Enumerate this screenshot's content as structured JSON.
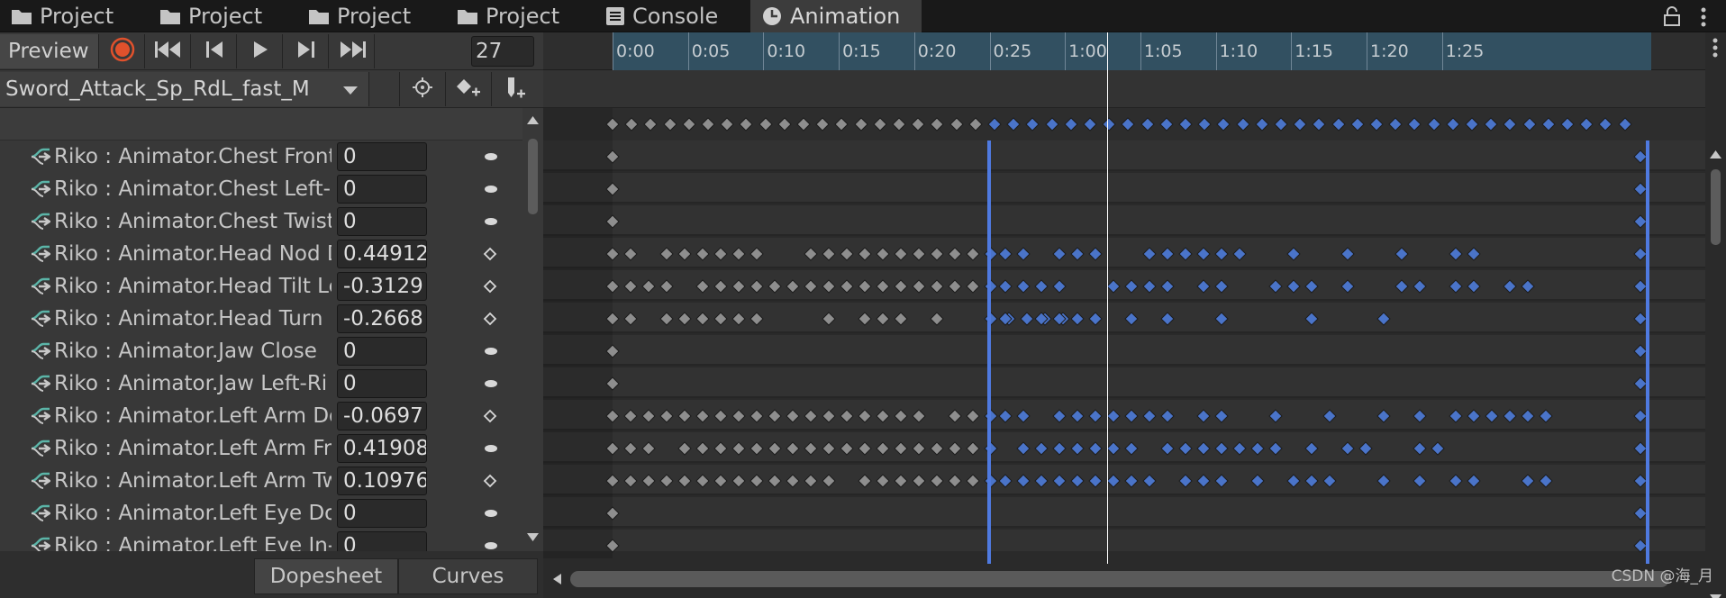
{
  "tabs": [
    {
      "label": "Project",
      "icon": "folder-icon"
    },
    {
      "label": "Project",
      "icon": "folder-icon"
    },
    {
      "label": "Project",
      "icon": "folder-icon"
    },
    {
      "label": "Project",
      "icon": "folder-icon"
    },
    {
      "label": "Console",
      "icon": "console-icon"
    },
    {
      "label": "Animation",
      "icon": "clock-icon",
      "active": true
    }
  ],
  "toolbar": {
    "preview_label": "Preview",
    "frame_value": "27",
    "record_color": "#e0512c"
  },
  "clip": {
    "name": "Sword_Attack_Sp_RdL_fast_M"
  },
  "ruler": {
    "ticks": [
      "0:00",
      "0:05",
      "0:10",
      "0:15",
      "0:20",
      "0:25",
      "1:00",
      "1:05",
      "1:10",
      "1:15",
      "1:20",
      "1:25"
    ]
  },
  "properties": [
    {
      "name": "Riko : Animator.Chest Front-",
      "value": "0",
      "key_icon": "curve-dot"
    },
    {
      "name": "Riko : Animator.Chest Left-R",
      "value": "0",
      "key_icon": "curve-dot"
    },
    {
      "name": "Riko : Animator.Chest Twist",
      "value": "0",
      "key_icon": "curve-dot"
    },
    {
      "name": "Riko : Animator.Head Nod D",
      "value": "0.44912",
      "key_icon": "diamond"
    },
    {
      "name": "Riko : Animator.Head Tilt Le",
      "value": "-0.3129",
      "key_icon": "diamond"
    },
    {
      "name": "Riko : Animator.Head Turn L",
      "value": "-0.2668",
      "key_icon": "diamond"
    },
    {
      "name": "Riko : Animator.Jaw Close",
      "value": "0",
      "key_icon": "curve-dot"
    },
    {
      "name": "Riko : Animator.Jaw Left-Ri",
      "value": "0",
      "key_icon": "curve-dot"
    },
    {
      "name": "Riko : Animator.Left Arm Do",
      "value": "-0.0697",
      "key_icon": "diamond"
    },
    {
      "name": "Riko : Animator.Left Arm Fro",
      "value": "0.41908",
      "key_icon": "curve-dot"
    },
    {
      "name": "Riko : Animator.Left Arm Tw",
      "value": "0.10976",
      "key_icon": "diamond"
    },
    {
      "name": "Riko : Animator.Left Eye Dov",
      "value": "0",
      "key_icon": "curve-dot"
    },
    {
      "name": "Riko : Animator.Left Eye In-(",
      "value": "0",
      "key_icon": "curve-dot"
    }
  ],
  "bottom_tabs": {
    "dopesheet": "Dopesheet",
    "curves": "Curves"
  },
  "colors": {
    "selected_key": "#4a74c9",
    "unselected_key": "#8e8e8e",
    "ruler_active": "#325061",
    "selection_line": "#4f7ae0"
  },
  "watermark": "CSDN @海_月"
}
